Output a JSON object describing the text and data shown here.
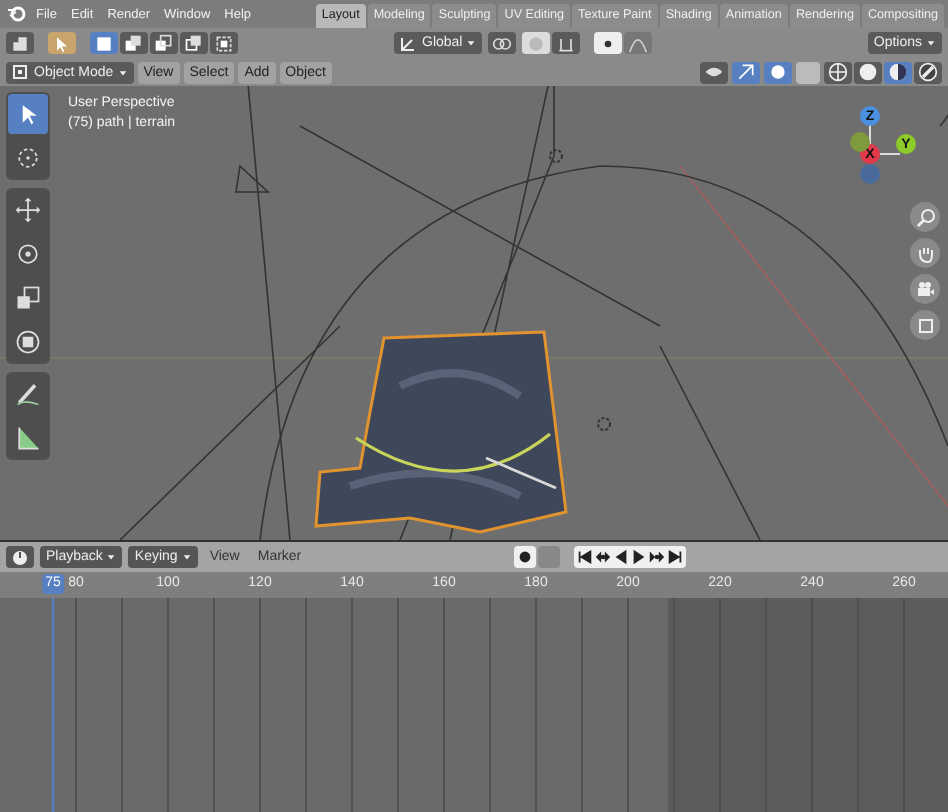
{
  "menu": [
    "File",
    "Edit",
    "Render",
    "Window",
    "Help"
  ],
  "workspace_tabs": [
    {
      "label": "Layout",
      "selected": true
    },
    {
      "label": "Modeling",
      "selected": false
    },
    {
      "label": "Sculpting",
      "selected": false
    },
    {
      "label": "UV Editing",
      "selected": false
    },
    {
      "label": "Texture Paint",
      "selected": false
    },
    {
      "label": "Shading",
      "selected": false
    },
    {
      "label": "Animation",
      "selected": false
    },
    {
      "label": "Rendering",
      "selected": false
    },
    {
      "label": "Compositing",
      "selected": false
    }
  ],
  "select_modes": [
    {
      "kind": "set",
      "selected": true
    },
    {
      "kind": "extend",
      "selected": false
    },
    {
      "kind": "subtract",
      "selected": false
    },
    {
      "kind": "invert",
      "selected": false
    },
    {
      "kind": "intersect",
      "selected": false
    }
  ],
  "tool_header": {
    "orientation": "Global",
    "options": "Options"
  },
  "viewport_header": {
    "mode": "Object Mode",
    "menus": [
      "View",
      "Select",
      "Add",
      "Object"
    ]
  },
  "shading": [
    {
      "kind": "wireframe",
      "selected": false
    },
    {
      "kind": "solid",
      "selected": false
    },
    {
      "kind": "material",
      "selected": true
    },
    {
      "kind": "rendered",
      "selected": false
    }
  ],
  "viewport": {
    "view_name": "User Perspective",
    "object_info": "(75) path | terrain",
    "axes": [
      {
        "label": "Z"
      },
      {
        "label": "X"
      },
      {
        "label": "Y"
      }
    ]
  },
  "tools": [
    [
      {
        "kind": "select",
        "selected": true
      },
      {
        "kind": "cursor",
        "selected": false
      }
    ],
    [
      {
        "kind": "move",
        "selected": false
      },
      {
        "kind": "rotate",
        "selected": false
      },
      {
        "kind": "scale",
        "selected": false
      },
      {
        "kind": "transform",
        "selected": false
      }
    ],
    [
      {
        "kind": "annotate",
        "selected": false
      },
      {
        "kind": "measure",
        "selected": false
      }
    ]
  ],
  "timeline": {
    "dropdowns": [
      "Playback",
      "Keying"
    ],
    "menus": [
      "View",
      "Marker"
    ],
    "current_frame": "75",
    "ruler": [
      "80",
      "100",
      "120",
      "140",
      "160",
      "180",
      "200",
      "220",
      "240",
      "260"
    ]
  }
}
